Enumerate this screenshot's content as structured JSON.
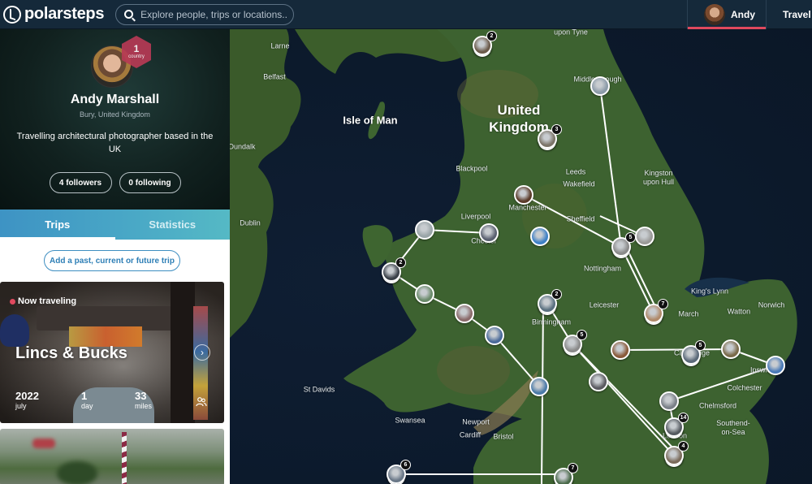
{
  "app": {
    "brand": "polarsteps",
    "search_placeholder": "Explore people, trips or locations...",
    "nav": {
      "user_label": "Andy",
      "travel_label": "Travel B",
      "accent_color": "#e0495e"
    }
  },
  "profile": {
    "name": "Andy Marshall",
    "location": "Bury, United Kingdom",
    "bio": "Travelling architectural photographer based in the UK",
    "countries_badge": {
      "count": "1",
      "label": "country"
    },
    "followers_label": "4 followers",
    "following_label": "0 following"
  },
  "tabs": [
    {
      "label": "Trips",
      "active": true
    },
    {
      "label": "Statistics",
      "active": false
    }
  ],
  "add_trip_label": "Add a past, current or future trip",
  "trips": [
    {
      "status": "Now traveling",
      "title": "Lincs & Bucks",
      "year": "2022",
      "month": "july",
      "days": "1",
      "days_unit": "day",
      "distance": "33",
      "distance_unit": "miles",
      "people_icon": "people-icon",
      "open_icon": "chevron-right-icon"
    },
    {
      "status": "",
      "title": ""
    }
  ],
  "map": {
    "labels": [
      {
        "text": "Larne",
        "kind": "city"
      },
      {
        "text": "Belfast",
        "kind": "city"
      },
      {
        "text": "Isle of Man",
        "kind": "mid"
      },
      {
        "text": "Dundalk",
        "kind": "city"
      },
      {
        "text": "Dublin",
        "kind": "city"
      },
      {
        "text": "United Kingdom",
        "kind": "big"
      },
      {
        "text": "Newcastle upon Tyne",
        "kind": "city"
      },
      {
        "text": "Middlesbrough",
        "kind": "city"
      },
      {
        "text": "Blackpool",
        "kind": "city"
      },
      {
        "text": "Leeds",
        "kind": "city"
      },
      {
        "text": "Wakefield",
        "kind": "city"
      },
      {
        "text": "Kingston upon Hull",
        "kind": "city"
      },
      {
        "text": "Manchester",
        "kind": "city"
      },
      {
        "text": "Liverpool",
        "kind": "city"
      },
      {
        "text": "Chester",
        "kind": "city"
      },
      {
        "text": "Sheffield",
        "kind": "city"
      },
      {
        "text": "Nottingham",
        "kind": "city"
      },
      {
        "text": "King's Lynn",
        "kind": "city"
      },
      {
        "text": "Leicester",
        "kind": "city"
      },
      {
        "text": "March",
        "kind": "city"
      },
      {
        "text": "Watton",
        "kind": "city"
      },
      {
        "text": "Norwich",
        "kind": "city"
      },
      {
        "text": "Birmingham",
        "kind": "city"
      },
      {
        "text": "Cambridge",
        "kind": "city"
      },
      {
        "text": "Ipswich",
        "kind": "city"
      },
      {
        "text": "Colchester",
        "kind": "city"
      },
      {
        "text": "Chelmsford",
        "kind": "city"
      },
      {
        "text": "Southend-on-Sea",
        "kind": "city"
      },
      {
        "text": "London",
        "kind": "city"
      },
      {
        "text": "St Davids",
        "kind": "city"
      },
      {
        "text": "Swansea",
        "kind": "city"
      },
      {
        "text": "Newport",
        "kind": "city"
      },
      {
        "text": "Cardiff",
        "kind": "city"
      },
      {
        "text": "Bristol",
        "kind": "city"
      }
    ],
    "step_counts": [
      "2",
      "3",
      "5",
      "7",
      "2",
      "2",
      "5",
      "5",
      "14",
      "4",
      "6",
      "7"
    ]
  }
}
